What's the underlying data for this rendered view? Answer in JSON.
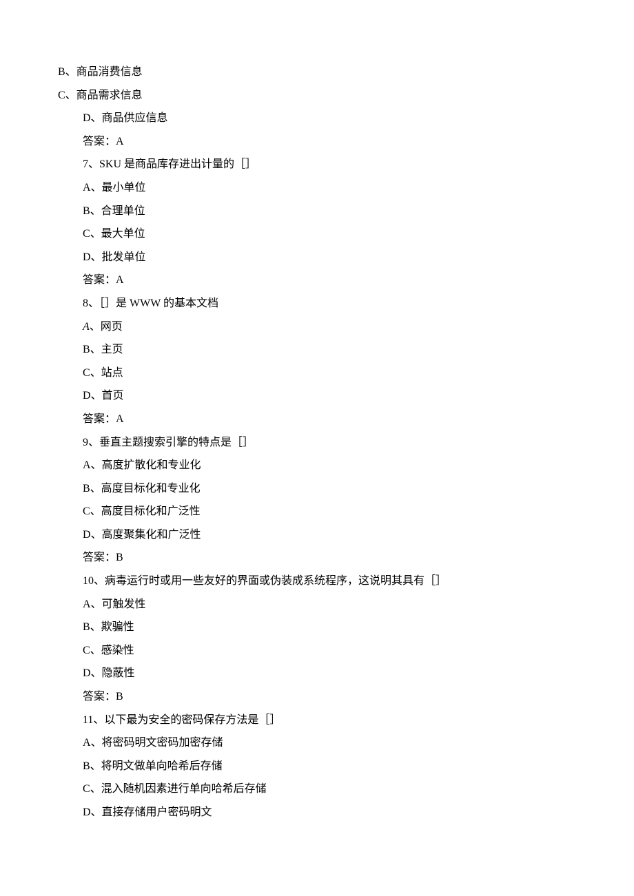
{
  "lines": [
    {
      "text": "B、商品消费信息",
      "outdent": true
    },
    {
      "text": "C、商品需求信息",
      "outdent": true
    },
    {
      "text": "D、商品供应信息"
    },
    {
      "text": "答案：A"
    },
    {
      "text": "7、SKU 是商品库存进出计量的［］"
    },
    {
      "text": "A、最小单位"
    },
    {
      "text": "B、合理单位"
    },
    {
      "text": "C、最大单位"
    },
    {
      "text": "D、批发单位"
    },
    {
      "text": "答案：A"
    },
    {
      "text": "8、［］是 WWW 的基本文档"
    },
    {
      "text": "、网页",
      "prefixItalicA": true
    },
    {
      "text": "B、主页"
    },
    {
      "text": "C、站点"
    },
    {
      "text": "D、首页"
    },
    {
      "text": "答案：A"
    },
    {
      "text": "9、垂直主题搜索引擎的特点是［］"
    },
    {
      "text": "A、高度扩散化和专业化"
    },
    {
      "text": "B、高度目标化和专业化"
    },
    {
      "text": "C、高度目标化和广泛性"
    },
    {
      "text": "D、高度聚集化和广泛性"
    },
    {
      "text": "答案：B"
    },
    {
      "text": "10、病毒运行时或用一些友好的界面或伪装成系统程序，这说明其具有［］"
    },
    {
      "text": "A、可触发性"
    },
    {
      "text": "B、欺骗性"
    },
    {
      "text": "C、感染性"
    },
    {
      "text": "D、隐蔽性"
    },
    {
      "text": "答案：B"
    },
    {
      "text": "11、以下最为安全的密码保存方法是［］"
    },
    {
      "text": "A、将密码明文密码加密存储"
    },
    {
      "text": "B、将明文做单向哈希后存储"
    },
    {
      "text": "C、混入随机因素进行单向哈希后存储"
    },
    {
      "text": "D、直接存储用户密码明文"
    }
  ]
}
